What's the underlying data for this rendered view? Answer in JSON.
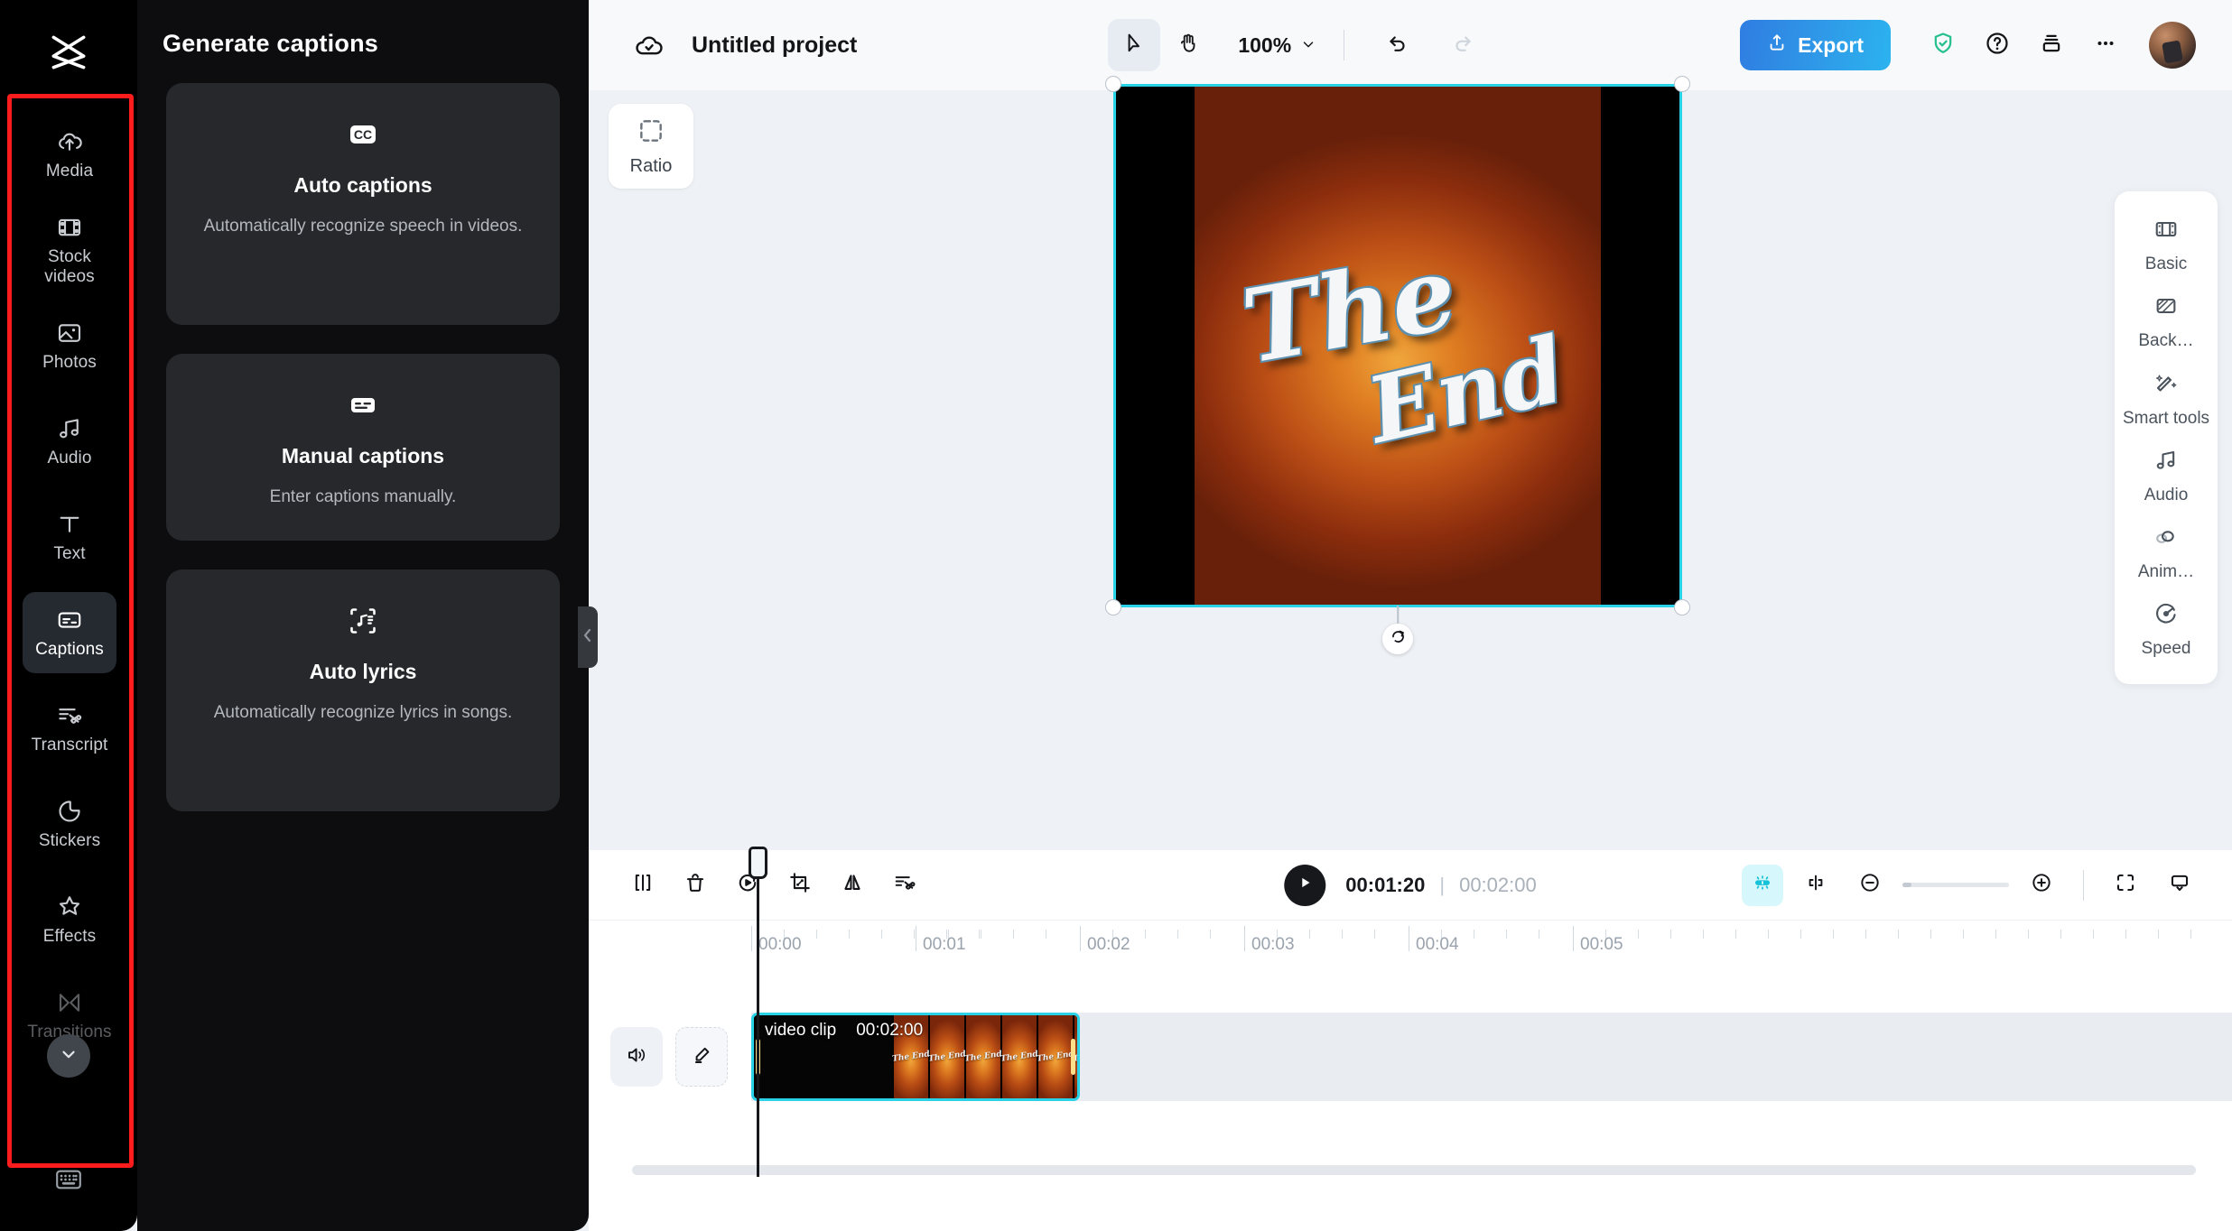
{
  "app": {
    "name": "CapCut",
    "logo_icon": "capcut-logo-icon"
  },
  "rail": {
    "items": [
      {
        "label": "Media",
        "icon": "cloud-upload-icon",
        "active": false
      },
      {
        "label": "Stock videos",
        "icon": "film-strip-icon",
        "active": false
      },
      {
        "label": "Photos",
        "icon": "image-icon",
        "active": false
      },
      {
        "label": "Audio",
        "icon": "music-note-icon",
        "active": false
      },
      {
        "label": "Text",
        "icon": "text-t-icon",
        "active": false
      },
      {
        "label": "Captions",
        "icon": "captions-icon",
        "active": true
      },
      {
        "label": "Transcript",
        "icon": "transcript-scissors-icon",
        "active": false
      },
      {
        "label": "Stickers",
        "icon": "sticker-icon",
        "active": false
      },
      {
        "label": "Effects",
        "icon": "sparkle-star-icon",
        "active": false
      },
      {
        "label": "Transitions",
        "icon": "transitions-icon",
        "active": false
      }
    ],
    "scroll_down_icon": "chevron-down-icon",
    "keyboard_icon": "keyboard-icon",
    "highlight_color": "#ff1c1c"
  },
  "panel": {
    "title": "Generate captions",
    "collapse_icon": "chevron-left-icon",
    "cards": [
      {
        "icon": "cc-icon",
        "title": "Auto captions",
        "desc": "Automatically recognize speech in videos."
      },
      {
        "icon": "manual-captions-icon",
        "title": "Manual captions",
        "desc": "Enter captions manually."
      },
      {
        "icon": "auto-lyrics-icon",
        "title": "Auto lyrics",
        "desc": "Automatically recognize lyrics in songs."
      }
    ]
  },
  "header": {
    "cloud_icon": "cloud-saved-icon",
    "project_title": "Untitled project",
    "cursor_tool_icon": "cursor-arrow-icon",
    "hand_tool_icon": "hand-icon",
    "zoom_level": "100%",
    "zoom_caret_icon": "chevron-down-icon",
    "undo_icon": "undo-icon",
    "redo_icon": "redo-icon",
    "export_label": "Export",
    "export_icon": "upload-icon",
    "export_color": "#2f8ce4",
    "shield_icon": "shield-check-icon",
    "shield_color": "#25c08b",
    "help_icon": "help-circle-icon",
    "layers_icon": "stack-layers-icon",
    "more_icon": "more-dots-icon",
    "avatar_icon": "user-avatar"
  },
  "stage": {
    "ratio_label": "Ratio",
    "ratio_icon": "aspect-ratio-icon",
    "rotate_icon": "rotate-icon",
    "preview_text_line1": "The",
    "preview_text_line2": "End"
  },
  "right_panel": {
    "items": [
      {
        "label": "Basic",
        "icon": "film-basic-icon"
      },
      {
        "label": "Back…",
        "icon": "background-icon"
      },
      {
        "label": "Smart tools",
        "icon": "magic-wand-icon"
      },
      {
        "label": "Audio",
        "icon": "music-note-icon"
      },
      {
        "label": "Anim…",
        "icon": "animation-icon"
      },
      {
        "label": "Speed",
        "icon": "speedometer-icon"
      }
    ]
  },
  "timeline": {
    "tools": [
      {
        "icon": "split-icon",
        "name": "split"
      },
      {
        "icon": "delete-trash-icon",
        "name": "delete"
      },
      {
        "icon": "rotate-play-icon",
        "name": "gif"
      },
      {
        "icon": "crop-icon",
        "name": "crop"
      },
      {
        "icon": "mirror-flip-icon",
        "name": "mirror"
      },
      {
        "icon": "transcript-scissors-icon",
        "name": "auto-cut"
      }
    ],
    "play_icon": "play-icon",
    "current_time": "00:01:20",
    "separator": "|",
    "total_time": "00:02:00",
    "snap_icon": "magnet-snap-icon",
    "snap_color": "#16c2d8",
    "split_view_icon": "split-view-icon",
    "zoom_out_icon": "minus-circle-icon",
    "zoom_in_icon": "plus-circle-icon",
    "fit_screen_icon": "fit-screen-icon",
    "preview_mode_icon": "preview-dropdown-icon",
    "ruler_labels": [
      "00:00",
      "00:01",
      "00:02",
      "00:03",
      "00:04",
      "00:05"
    ],
    "mute_icon": "speaker-icon",
    "edit_icon": "pencil-icon",
    "clip": {
      "name": "video clip",
      "duration": "00:02:00"
    }
  }
}
